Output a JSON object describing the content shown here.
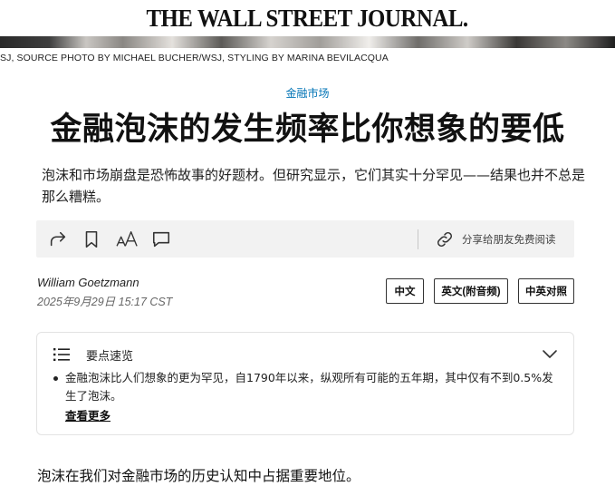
{
  "masthead": {
    "logo_text": "THE WALL STREET JOURNAL."
  },
  "photo_credit": "SJ, SOURCE PHOTO BY MICHAEL BUCHER/WSJ, STYLING BY MARINA BEVILACQUA",
  "section": {
    "label": "金融市场"
  },
  "headline": "金融泡沫的发生频率比你想象的要低",
  "dek": "泡沫和市场崩盘是恐怖故事的好题材。但研究显示，它们其实十分罕见——结果也并不总是那么糟糕。",
  "toolbar": {
    "icons": [
      "share-icon",
      "bookmark-icon",
      "text-size-icon",
      "comment-icon",
      "link-icon"
    ],
    "share_gift_label": "分享给朋友免费阅读"
  },
  "byline": {
    "author": "William Goetzmann",
    "timestamp": "2025年9月29日 15:17 CST"
  },
  "language_buttons": [
    {
      "label": "中文"
    },
    {
      "label": "英文(附音频)"
    },
    {
      "label": "中英对照"
    }
  ],
  "key_points": {
    "title": "要点速览",
    "bullets": [
      "金融泡沫比人们想象的更为罕见，自1790年以来，纵观所有可能的五年期，其中仅有不到0.5%发生了泡沫。"
    ],
    "see_more_label": "查看更多"
  },
  "body": {
    "first_paragraph": "泡沫在我们对金融市场的历史认知中占据重要地位。"
  },
  "colors": {
    "section_link": "#0274b6",
    "toolbar_bg": "#f2f2f2",
    "text": "#111111"
  }
}
